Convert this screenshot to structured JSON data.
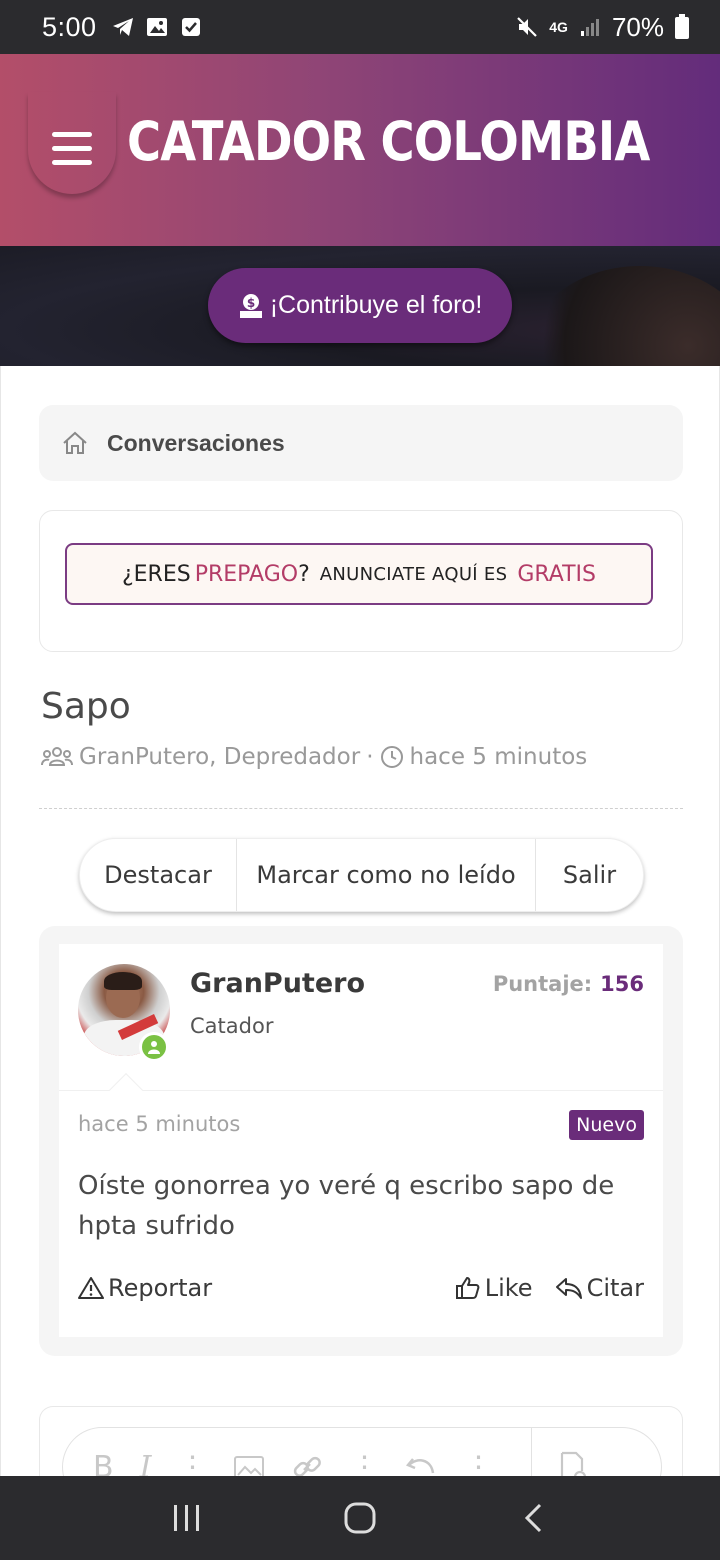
{
  "status_bar": {
    "time": "5:00",
    "left_icons": [
      "telegram-icon",
      "gallery-icon",
      "checkbox-icon"
    ],
    "right_icons": [
      "mute-icon",
      "4g-icon",
      "signal-icon",
      "battery-icon"
    ],
    "network": "4G",
    "battery": "70%"
  },
  "header": {
    "brand": "CATADOR COLOMBIA",
    "menu_icon": "hamburger-icon",
    "gradient": [
      "#b34e69",
      "#632c7b"
    ]
  },
  "hero": {
    "contribute_label": "¡Contribuye el foro!",
    "contribute_icon": "donate-icon"
  },
  "breadcrumb": {
    "icon": "home-icon",
    "label": "Conversaciones"
  },
  "ad_banner": {
    "part1": "¿ERES",
    "part2": "PREPAGO",
    "part3": "?",
    "part4": "ANUNCIATE AQUÍ ES",
    "part5": "GRATIS"
  },
  "thread": {
    "title": "Sapo",
    "participants": "GranPutero, Depredador",
    "separator": "·",
    "time": "hace 5 minutos"
  },
  "actions": {
    "highlight": "Destacar",
    "mark_unread": "Marcar como no leído",
    "leave": "Salir"
  },
  "post": {
    "username": "GranPutero",
    "user_title": "Catador",
    "score_label": "Puntaje:",
    "score_value": "156",
    "time": "hace 5 minutos",
    "badge": "Nuevo",
    "body": "Oíste gonorrea yo veré q escribo sapo de hpta sufrido",
    "report": "Reportar",
    "like": "Like",
    "quote": "Citar"
  },
  "editor": {
    "bold": "B",
    "italic": "I"
  },
  "colors": {
    "accent": "#6a2c7a",
    "online": "#7ac143"
  }
}
